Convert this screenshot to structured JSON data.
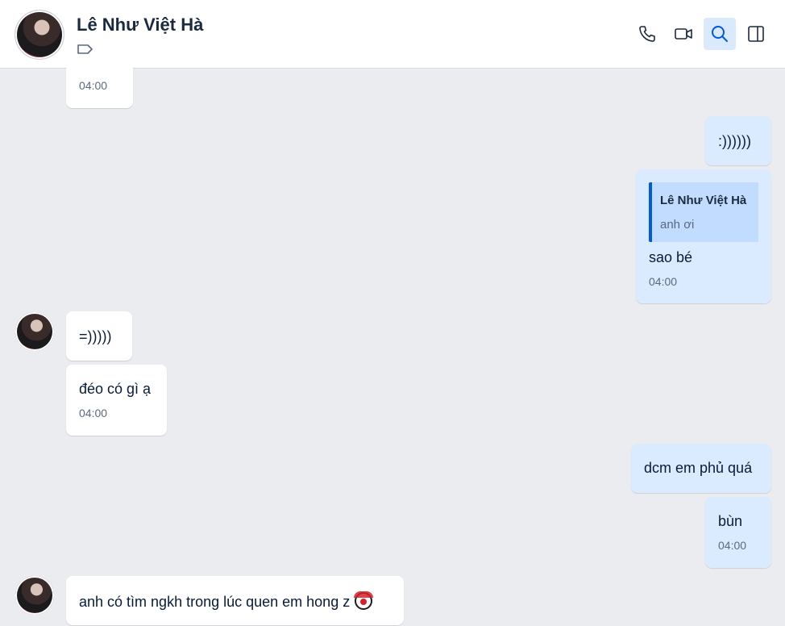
{
  "header": {
    "title": "Lê Như Việt Hà"
  },
  "icons": {
    "tag": "tag-icon",
    "call": "phone-icon",
    "video": "video-camera-icon",
    "search": "search-icon",
    "panel": "sidebar-toggle-icon"
  },
  "colors": {
    "accent": "#005ae0",
    "incoming_bubble": "#ffffff",
    "outgoing_bubble": "#dbebff",
    "chat_background": "#ebecf0"
  },
  "messages": [
    {
      "time": "04:00"
    },
    {
      "text": ":))))))"
    },
    {
      "quote_name": "Lê Như Việt Hà",
      "quote_text": "anh ơi",
      "text": "sao bé",
      "time": "04:00"
    },
    {
      "text": "=)))))"
    },
    {
      "text": "đéo có gì ạ",
      "time": "04:00"
    },
    {
      "text": "dcm em phủ quá"
    },
    {
      "text": "bùn",
      "time": "04:00"
    },
    {
      "text": "anh có tìm ngkh trong lúc quen em hong z"
    }
  ]
}
